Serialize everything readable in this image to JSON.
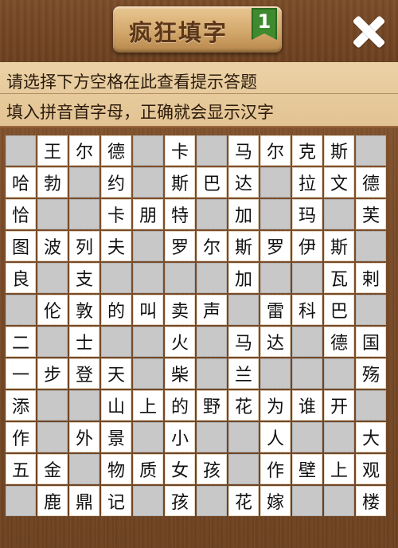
{
  "header": {
    "title": "疯狂填字",
    "level": "1",
    "close_icon": "close-x-icon"
  },
  "hints": {
    "line1": "请选择下方空格在此查看提示答题",
    "line2": "填入拼音首字母，正确就会显示汉字"
  },
  "colors": {
    "wood": "#7a4b27",
    "hint_bg": "#e8cb9d",
    "filled_cell": "#ffffff",
    "empty_cell": "#c8c8c8",
    "badge": "#3f8a2f"
  },
  "grid": {
    "rows": [
      [
        "",
        "王",
        "尔",
        "德",
        "",
        "卡",
        "",
        "马",
        "尔",
        "克",
        "斯",
        ""
      ],
      [
        "哈",
        "勃",
        "",
        "约",
        "",
        "斯",
        "巴",
        "达",
        "",
        "拉",
        "文",
        "德"
      ],
      [
        "恰",
        "",
        "",
        "卡",
        "朋",
        "特",
        "",
        "加",
        "",
        "玛",
        "",
        "芙"
      ],
      [
        "图",
        "波",
        "列",
        "夫",
        "",
        "罗",
        "尔",
        "斯",
        "罗",
        "伊",
        "斯",
        ""
      ],
      [
        "良",
        "",
        "支",
        "",
        "",
        "",
        "",
        "加",
        "",
        "",
        "瓦",
        "剌"
      ],
      [
        "",
        "伦",
        "敦",
        "的",
        "叫",
        "卖",
        "声",
        "",
        "雷",
        "科",
        "巴",
        ""
      ],
      [
        "二",
        "",
        "士",
        "",
        "",
        "火",
        "",
        "马",
        "达",
        "",
        "德",
        "国"
      ],
      [
        "一",
        "步",
        "登",
        "天",
        "",
        "柴",
        "",
        "兰",
        "",
        "",
        "",
        "殇"
      ],
      [
        "添",
        "",
        "",
        "山",
        "上",
        "的",
        "野",
        "花",
        "为",
        "谁",
        "开",
        ""
      ],
      [
        "作",
        "",
        "外",
        "景",
        "",
        "小",
        "",
        "",
        "人",
        "",
        "",
        "大"
      ],
      [
        "五",
        "金",
        "",
        "物",
        "质",
        "女",
        "孩",
        "",
        "作",
        "壁",
        "上",
        "观"
      ],
      [
        "",
        "鹿",
        "鼎",
        "记",
        "",
        "孩",
        "",
        "花",
        "嫁",
        "",
        "",
        "楼"
      ]
    ]
  }
}
